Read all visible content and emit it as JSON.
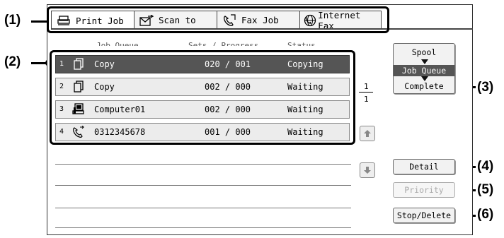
{
  "callouts": [
    "(1)",
    "(2)",
    "(3)",
    "(4)",
    "(5)",
    "(6)"
  ],
  "tabs": [
    {
      "label": "Print Job",
      "icon": "printer-icon",
      "active": true
    },
    {
      "label": "Scan to",
      "icon": "scan-icon",
      "active": false
    },
    {
      "label": "Fax Job",
      "icon": "fax-icon",
      "active": false
    },
    {
      "label": "Internet Fax",
      "icon": "internet-fax-icon",
      "active": false
    }
  ],
  "columns": [
    "Job Queue",
    "Sets / Progress",
    "Status"
  ],
  "jobs": [
    {
      "index": "1",
      "icon": "copy-icon",
      "name": "Copy",
      "progress": "020 / 001",
      "status": "Copying",
      "selected": true
    },
    {
      "index": "2",
      "icon": "copy-icon",
      "name": "Copy",
      "progress": "002 / 000",
      "status": "Waiting",
      "selected": false
    },
    {
      "index": "3",
      "icon": "computer-icon",
      "name": "Computer01",
      "progress": "002 / 000",
      "status": "Waiting",
      "selected": false
    },
    {
      "index": "4",
      "icon": "fax-icon",
      "name": "0312345678",
      "progress": "001 / 000",
      "status": "Waiting",
      "selected": false
    }
  ],
  "pager": {
    "current": "1",
    "total": "1"
  },
  "spool": {
    "options": [
      "Spool",
      "Job Queue",
      "Complete"
    ],
    "current": "Job Queue"
  },
  "buttons": {
    "detail": "Detail",
    "priority": "Priority",
    "stop_delete": "Stop/Delete"
  },
  "colors": {
    "selected_row": "#555555",
    "row_bg": "#ececec",
    "disabled_text": "#aaaaaa"
  }
}
